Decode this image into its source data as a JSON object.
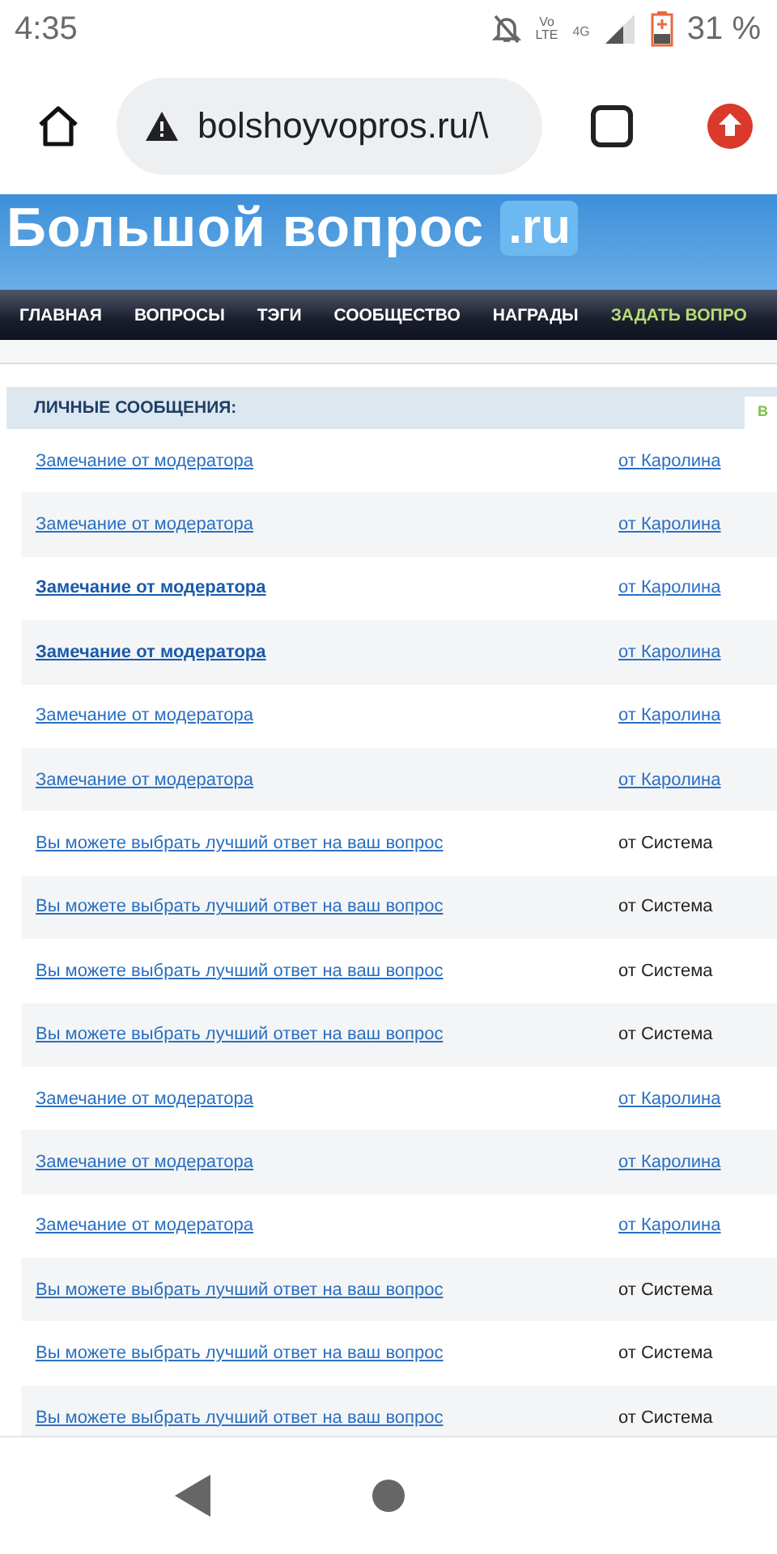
{
  "status_bar": {
    "time": "4:35",
    "volte": "Vo LTE",
    "network": "4G",
    "battery": "31 %"
  },
  "browser": {
    "url": "bolshoyvopros.ru/\\"
  },
  "site": {
    "logo": "Большой вопрос",
    "logo_domain": ".ru",
    "nav": [
      {
        "label": "ГЛАВНАЯ",
        "kind": "plain"
      },
      {
        "label": "ВОПРОСЫ",
        "kind": "plain"
      },
      {
        "label": "ТЭГИ",
        "kind": "plain"
      },
      {
        "label": "СООБЩЕСТВО",
        "kind": "plain"
      },
      {
        "label": "НАГРАДЫ",
        "kind": "plain"
      },
      {
        "label": "ЗАДАТЬ ВОПРО",
        "kind": "accent"
      }
    ]
  },
  "messages": {
    "title": "ЛИЧНЫЕ СООБЩЕНИЯ:",
    "side_tab": "В",
    "rows": [
      {
        "subject": "Замечание от модератора",
        "unread": false,
        "sender": "от Каролина",
        "sender_link": true
      },
      {
        "subject": "Замечание от модератора",
        "unread": false,
        "sender": "от Каролина",
        "sender_link": true
      },
      {
        "subject": "Замечание от модератора",
        "unread": true,
        "sender": "от Каролина",
        "sender_link": true
      },
      {
        "subject": "Замечание от модератора",
        "unread": true,
        "sender": "от Каролина",
        "sender_link": true
      },
      {
        "subject": "Замечание от модератора",
        "unread": false,
        "sender": "от Каролина",
        "sender_link": true
      },
      {
        "subject": "Замечание от модератора",
        "unread": false,
        "sender": "от Каролина",
        "sender_link": true
      },
      {
        "subject": "Вы можете выбрать лучший ответ на ваш вопрос",
        "unread": false,
        "sender": "от Система",
        "sender_link": false
      },
      {
        "subject": "Вы можете выбрать лучший ответ на ваш вопрос",
        "unread": false,
        "sender": "от Система",
        "sender_link": false
      },
      {
        "subject": "Вы можете выбрать лучший ответ на ваш вопрос",
        "unread": false,
        "sender": "от Система",
        "sender_link": false
      },
      {
        "subject": "Вы можете выбрать лучший ответ на ваш вопрос",
        "unread": false,
        "sender": "от Система",
        "sender_link": false
      },
      {
        "subject": "Замечание от модератора",
        "unread": false,
        "sender": "от Каролина",
        "sender_link": true
      },
      {
        "subject": "Замечание от модератора",
        "unread": false,
        "sender": "от Каролина",
        "sender_link": true
      },
      {
        "subject": "Замечание от модератора",
        "unread": false,
        "sender": "от Каролина",
        "sender_link": true
      },
      {
        "subject": "Вы можете выбрать лучший ответ на ваш вопрос",
        "unread": false,
        "sender": "от Система",
        "sender_link": false
      },
      {
        "subject": "Вы можете выбрать лучший ответ на ваш вопрос",
        "unread": false,
        "sender": "от Система",
        "sender_link": false
      },
      {
        "subject": "Вы можете выбрать лучший ответ на ваш вопрос",
        "unread": false,
        "sender": "от Система",
        "sender_link": false
      }
    ]
  }
}
